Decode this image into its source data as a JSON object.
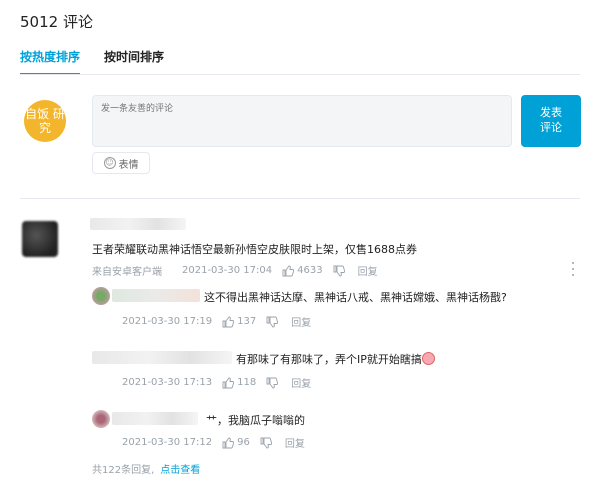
{
  "header": {
    "title": "5012 评论"
  },
  "tabs": [
    {
      "label": "按热度排序"
    },
    {
      "label": "按时间排序"
    }
  ],
  "composer": {
    "avatar_text": "自饭 研究",
    "placeholder": "发一条友善的评论",
    "submit_label": "发表 评论",
    "emoji_label": "表情"
  },
  "comments": [
    {
      "content": "王者荣耀联动黑神话悟空最新孙悟空皮肤限时上架，仅售1688点券",
      "source": "来自安卓客户端",
      "time": "2021-03-30 17:04",
      "likes": "4633",
      "reply_label": "回复"
    }
  ],
  "replies": [
    {
      "content": "这不得出黑神话达摩、黑神话八戒、黑神话嫦娥、黑神话杨戬?",
      "time": "2021-03-30 17:19",
      "likes": "137",
      "reply_label": "回复"
    },
    {
      "content": "有那味了有那味了，弄个IP就开始瞎搞",
      "time": "2021-03-30 17:13",
      "likes": "118",
      "reply_label": "回复"
    },
    {
      "content": "艹，我脑瓜子嗡嗡的",
      "time": "2021-03-30 17:12",
      "likes": "96",
      "reply_label": "回复"
    }
  ],
  "footer": {
    "total": "共122条回复,",
    "more_link": "点击查看"
  },
  "colors": {
    "accent": "#00a1d6",
    "muted": "#99a2aa",
    "divider": "#e5e9ef"
  }
}
